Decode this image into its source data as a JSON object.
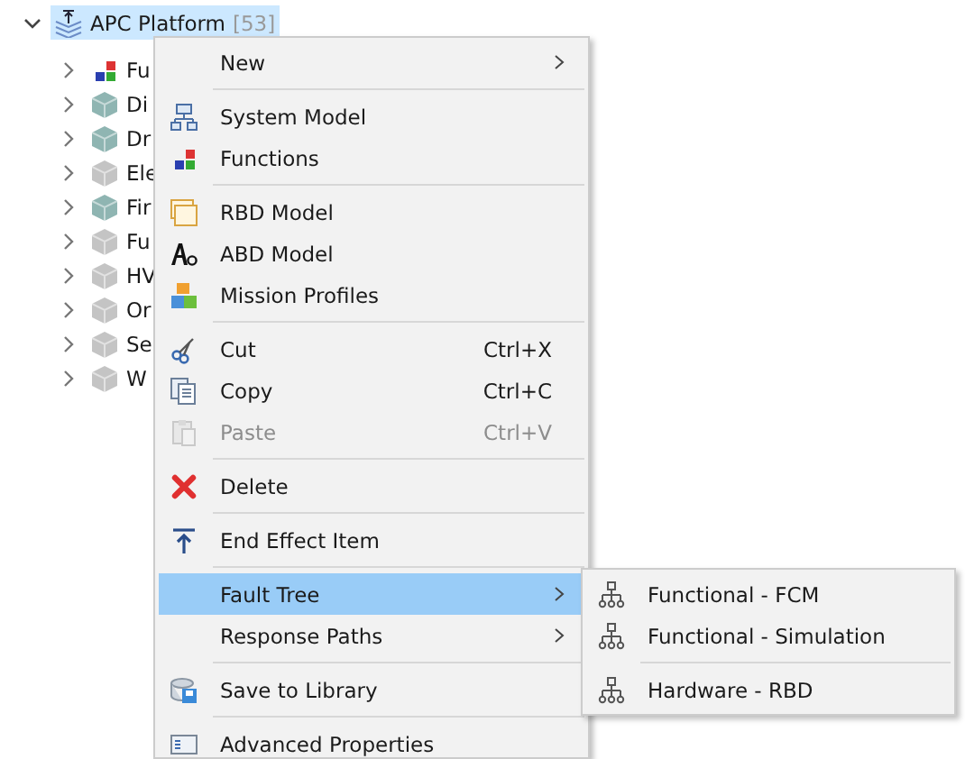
{
  "tree": {
    "label": "APC Platform",
    "count": "[53]",
    "expanded": true,
    "selected": true,
    "children": [
      {
        "label": "Fu",
        "kind": "functions",
        "expanded": false
      },
      {
        "label": "Di",
        "kind": "cube",
        "color": "#8fb5b2",
        "expanded": false
      },
      {
        "label": "Dr",
        "kind": "cube",
        "color": "#8fb5b2",
        "expanded": false
      },
      {
        "label": "Ele",
        "kind": "cube",
        "color": "#c4c4c4",
        "expanded": false
      },
      {
        "label": "Fir",
        "kind": "cube",
        "color": "#8fb5b2",
        "expanded": false
      },
      {
        "label": "Fu",
        "kind": "cube",
        "color": "#c4c4c4",
        "expanded": false
      },
      {
        "label": "HV",
        "kind": "cube",
        "color": "#c4c4c4",
        "expanded": false
      },
      {
        "label": "Or",
        "kind": "cube",
        "color": "#c4c4c4",
        "expanded": false
      },
      {
        "label": "Se",
        "kind": "cube",
        "color": "#c4c4c4",
        "expanded": false
      },
      {
        "label": "W",
        "kind": "cube",
        "color": "#c4c4c4",
        "expanded": false
      }
    ]
  },
  "context_menu": [
    {
      "kind": "item",
      "label": "New",
      "submenu": true,
      "selected": false,
      "disabled": false
    },
    {
      "kind": "separator"
    },
    {
      "kind": "item",
      "label": "System Model",
      "selected": false,
      "disabled": false
    },
    {
      "kind": "item",
      "label": "Functions",
      "selected": false,
      "disabled": false
    },
    {
      "kind": "separator"
    },
    {
      "kind": "item",
      "label": "RBD Model",
      "selected": false,
      "disabled": false
    },
    {
      "kind": "item",
      "label": "ABD Model",
      "selected": false,
      "disabled": false
    },
    {
      "kind": "item",
      "label": "Mission Profiles",
      "selected": false,
      "disabled": false
    },
    {
      "kind": "separator"
    },
    {
      "kind": "item",
      "label": "Cut",
      "shortcut": "Ctrl+X",
      "selected": false,
      "disabled": false
    },
    {
      "kind": "item",
      "label": "Copy",
      "shortcut": "Ctrl+C",
      "selected": false,
      "disabled": false
    },
    {
      "kind": "item",
      "label": "Paste",
      "shortcut": "Ctrl+V",
      "selected": false,
      "disabled": true
    },
    {
      "kind": "separator"
    },
    {
      "kind": "item",
      "label": "Delete",
      "selected": false,
      "disabled": false
    },
    {
      "kind": "separator"
    },
    {
      "kind": "item",
      "label": "End Effect Item",
      "selected": false,
      "disabled": false
    },
    {
      "kind": "separator"
    },
    {
      "kind": "item",
      "label": "Fault Tree",
      "submenu": true,
      "selected": true,
      "disabled": false
    },
    {
      "kind": "item",
      "label": "Response Paths",
      "submenu": true,
      "selected": false,
      "disabled": false
    },
    {
      "kind": "separator"
    },
    {
      "kind": "item",
      "label": "Save to Library",
      "selected": false,
      "disabled": false
    },
    {
      "kind": "separator"
    },
    {
      "kind": "item",
      "label": "Advanced Properties",
      "selected": false,
      "disabled": false
    }
  ],
  "submenu": [
    {
      "kind": "item",
      "label": "Functional - FCM",
      "selected": false,
      "disabled": false
    },
    {
      "kind": "item",
      "label": "Functional - Simulation",
      "selected": false,
      "disabled": false
    },
    {
      "kind": "separator"
    },
    {
      "kind": "item",
      "label": "Hardware - RBD",
      "selected": false,
      "disabled": false
    }
  ]
}
